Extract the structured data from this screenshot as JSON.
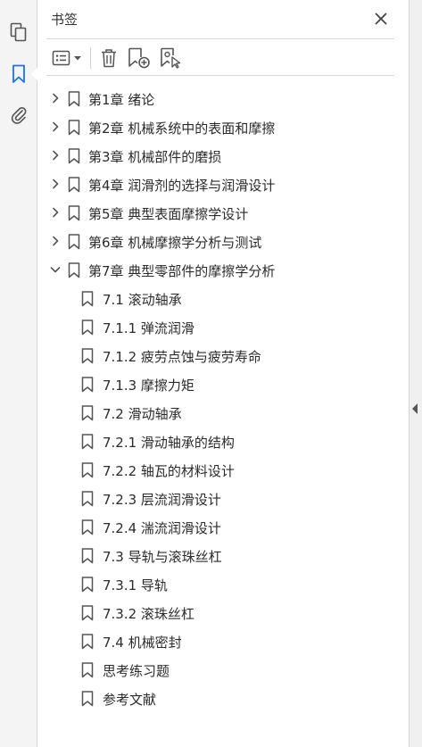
{
  "panel": {
    "title": "书签"
  },
  "rail": {
    "icons": [
      "pages-icon",
      "bookmark-icon",
      "attachment-icon"
    ]
  },
  "toolbar": {
    "buttons": [
      "options-menu",
      "delete-bookmark",
      "new-bookmark",
      "new-bookmark-from-structure"
    ]
  },
  "colors": {
    "accent": "#1a73e8",
    "icon": "#555555",
    "text": "#2b2b2b"
  },
  "bookmarks": [
    {
      "label": "第1章  绪论",
      "level": 0,
      "state": "collapsed"
    },
    {
      "label": "第2章  机械系统中的表面和摩擦",
      "level": 0,
      "state": "collapsed"
    },
    {
      "label": "第3章  机械部件的磨损",
      "level": 0,
      "state": "collapsed"
    },
    {
      "label": "第4章  润滑剂的选择与润滑设计",
      "level": 0,
      "state": "collapsed"
    },
    {
      "label": "第5章  典型表面摩擦学设计",
      "level": 0,
      "state": "collapsed"
    },
    {
      "label": "第6章  机械摩擦学分析与测试",
      "level": 0,
      "state": "collapsed"
    },
    {
      "label": "第7章  典型零部件的摩擦学分析",
      "level": 0,
      "state": "expanded"
    },
    {
      "label": "7.1  滚动轴承",
      "level": 1,
      "state": "leaf"
    },
    {
      "label": "7.1.1  弹流润滑",
      "level": 1,
      "state": "leaf"
    },
    {
      "label": "7.1.2  疲劳点蚀与疲劳寿命",
      "level": 1,
      "state": "leaf"
    },
    {
      "label": "7.1.3  摩擦力矩",
      "level": 1,
      "state": "leaf"
    },
    {
      "label": "7.2  滑动轴承",
      "level": 1,
      "state": "leaf"
    },
    {
      "label": "7.2.1  滑动轴承的结构",
      "level": 1,
      "state": "leaf"
    },
    {
      "label": "7.2.2  轴瓦的材料设计",
      "level": 1,
      "state": "leaf"
    },
    {
      "label": "7.2.3  层流润滑设计",
      "level": 1,
      "state": "leaf"
    },
    {
      "label": "7.2.4  湍流润滑设计",
      "level": 1,
      "state": "leaf"
    },
    {
      "label": "7.3  导轨与滚珠丝杠",
      "level": 1,
      "state": "leaf"
    },
    {
      "label": "7.3.1  导轨",
      "level": 1,
      "state": "leaf"
    },
    {
      "label": "7.3.2  滚珠丝杠",
      "level": 1,
      "state": "leaf"
    },
    {
      "label": "7.4  机械密封",
      "level": 1,
      "state": "leaf"
    },
    {
      "label": "思考练习题",
      "level": 1,
      "state": "leaf"
    },
    {
      "label": "参考文献",
      "level": 1,
      "state": "leaf"
    }
  ]
}
